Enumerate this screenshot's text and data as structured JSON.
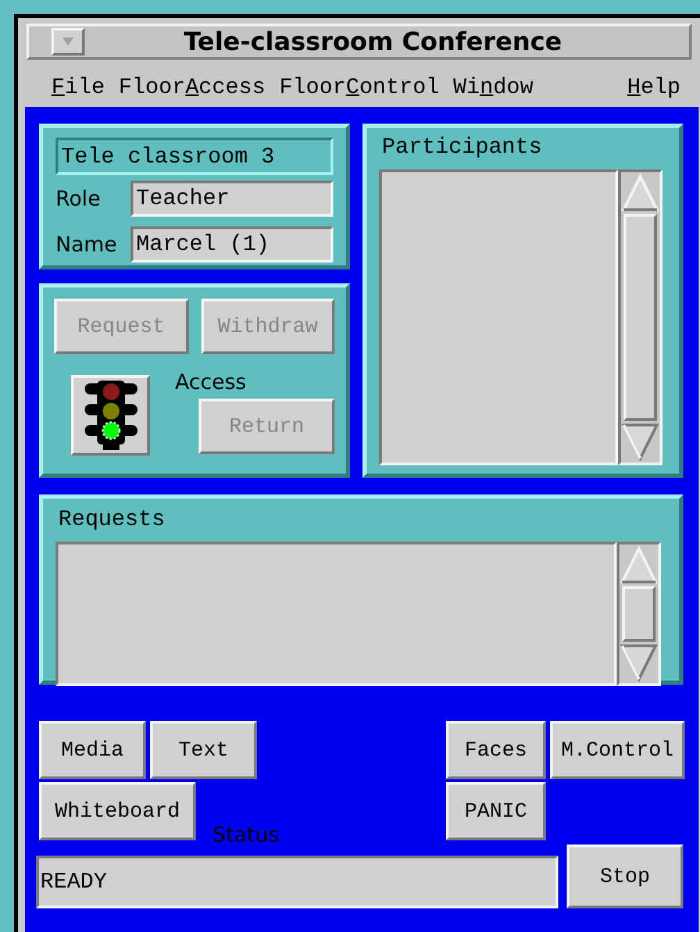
{
  "window": {
    "title": "Tele-classroom Conference"
  },
  "menu": [
    {
      "parts": [
        {
          "text": "F",
          "underline": true
        },
        {
          "text": "ile",
          "underline": false
        }
      ]
    },
    {
      "parts": [
        {
          "text": "Floor",
          "underline": false
        },
        {
          "text": "A",
          "underline": true
        },
        {
          "text": "ccess",
          "underline": false
        }
      ]
    },
    {
      "parts": [
        {
          "text": "Floor",
          "underline": false
        },
        {
          "text": "C",
          "underline": true
        },
        {
          "text": "ontrol",
          "underline": false
        }
      ]
    },
    {
      "parts": [
        {
          "text": "Wi",
          "underline": false
        },
        {
          "text": "n",
          "underline": true
        },
        {
          "text": "dow",
          "underline": false
        }
      ]
    },
    {
      "parts": [
        {
          "text": "H",
          "underline": true
        },
        {
          "text": "elp",
          "underline": false
        }
      ]
    }
  ],
  "session": {
    "room": "Tele classroom 3",
    "fields": [
      {
        "label": "Role",
        "value": "Teacher"
      },
      {
        "label": "Name",
        "value": "Marcel (1)"
      }
    ]
  },
  "access": {
    "label": "Access",
    "lights": [
      {
        "color": "#8b1a1a",
        "on": false
      },
      {
        "color": "#7f7f00",
        "on": false
      },
      {
        "color": "#00ff00",
        "on": true
      }
    ],
    "buttons": [
      {
        "label": "Request",
        "disabled": true
      },
      {
        "label": "Withdraw",
        "disabled": true
      },
      {
        "label": "Return",
        "disabled": true
      }
    ]
  },
  "participants": {
    "title": "Participants"
  },
  "requests": {
    "title": "Requests"
  },
  "tool_rows": [
    {
      "left": [
        "Media",
        "Text"
      ],
      "right": [
        "Faces",
        "M.Control"
      ]
    },
    {
      "left": [
        "Whiteboard"
      ],
      "right": [
        "PANIC"
      ]
    }
  ],
  "status": {
    "label": "Status",
    "value": "READY"
  },
  "stop_button": "Stop"
}
